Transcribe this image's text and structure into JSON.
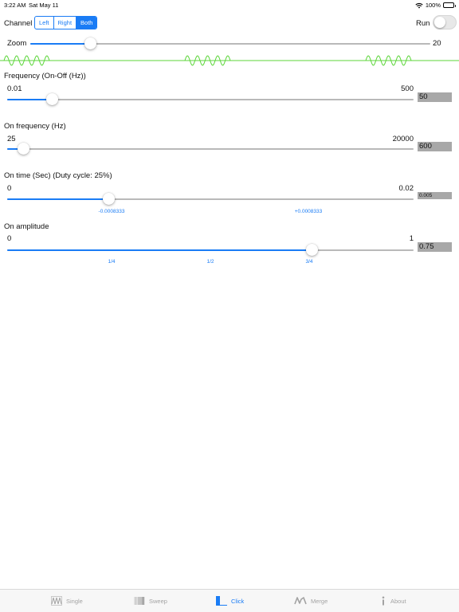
{
  "status": {
    "time": "3:22 AM",
    "date": "Sat May 11",
    "battery": "100%"
  },
  "channel": {
    "label": "Channel",
    "options": [
      "Left",
      "Right",
      "Both"
    ],
    "selected": "Both"
  },
  "run": {
    "label": "Run",
    "on": false
  },
  "zoom": {
    "label": "Zoom",
    "value_text": "20",
    "level": 0.15
  },
  "frequency": {
    "label": "Frequency (On-Off (Hz))",
    "min": "0.01",
    "max": "500",
    "value": "50",
    "level": 0.11
  },
  "on_frequency": {
    "label": "On frequency (Hz)",
    "min": "25",
    "max": "20000",
    "value": "600",
    "level": 0.04
  },
  "on_time": {
    "label": "On time (Sec) (Duty cycle: 25%)",
    "min": "0",
    "max": "0.02",
    "value": "0.005",
    "level": 0.25,
    "ticks": [
      "-0.0008333",
      "+0.0008333"
    ]
  },
  "on_amplitude": {
    "label": "On amplitude",
    "min": "0",
    "max": "1",
    "value": "0.75",
    "level": 0.75,
    "ticks": [
      "1/4",
      "1/2",
      "3/4"
    ]
  },
  "tabs": [
    {
      "label": "Single",
      "icon": "single-wave-icon",
      "active": false
    },
    {
      "label": "Sweep",
      "icon": "sweep-icon",
      "active": false
    },
    {
      "label": "Click",
      "icon": "click-pulse-icon",
      "active": true
    },
    {
      "label": "Merge",
      "icon": "merge-wave-icon",
      "active": false
    },
    {
      "label": "About",
      "icon": "info-icon",
      "active": false
    }
  ],
  "colors": {
    "accent": "#1a7cf5",
    "waveform": "#5cd63a",
    "value_box": "#a8a8a8"
  }
}
